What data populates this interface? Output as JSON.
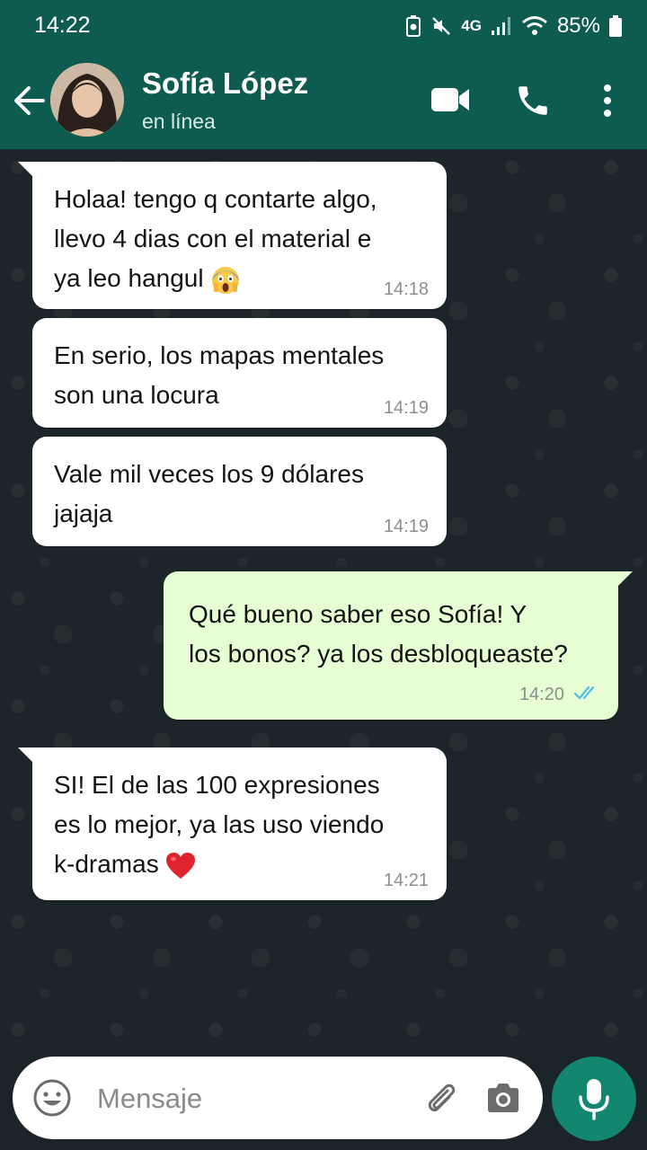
{
  "status_bar": {
    "time": "14:22",
    "network": "4G",
    "battery": "85%"
  },
  "header": {
    "contact_name": "Sofía López",
    "contact_status": "en línea"
  },
  "messages": [
    {
      "direction": "in",
      "lines": [
        "Holaa! tengo q contarte algo,",
        "llevo 4 dias con el material e",
        "ya leo hangul"
      ],
      "emoji": "scream-emoji",
      "time": "14:18"
    },
    {
      "direction": "in",
      "lines": [
        "En serio, los mapas mentales",
        "son una locura"
      ],
      "time": "14:19"
    },
    {
      "direction": "in",
      "lines": [
        "Vale mil veces los 9 dólares",
        "jajaja"
      ],
      "time": "14:19"
    },
    {
      "direction": "out",
      "lines": [
        "Qué bueno saber eso Sofía! Y",
        "los bonos? ya los desbloqueaste?"
      ],
      "time": "14:20",
      "read_status": "read"
    },
    {
      "direction": "in",
      "lines": [
        "SI! El de las 100 expresiones",
        "es lo mejor, ya las uso viendo",
        "k-dramas"
      ],
      "emoji": "red-heart-emoji",
      "time": "14:21"
    }
  ],
  "input": {
    "placeholder": "Mensaje"
  },
  "colors": {
    "header": "#0d5c4f",
    "outgoing_bubble": "#e7fdd3",
    "incoming_bubble": "#ffffff",
    "mic_button": "#12866e",
    "read_ticks": "#53bdeb"
  }
}
